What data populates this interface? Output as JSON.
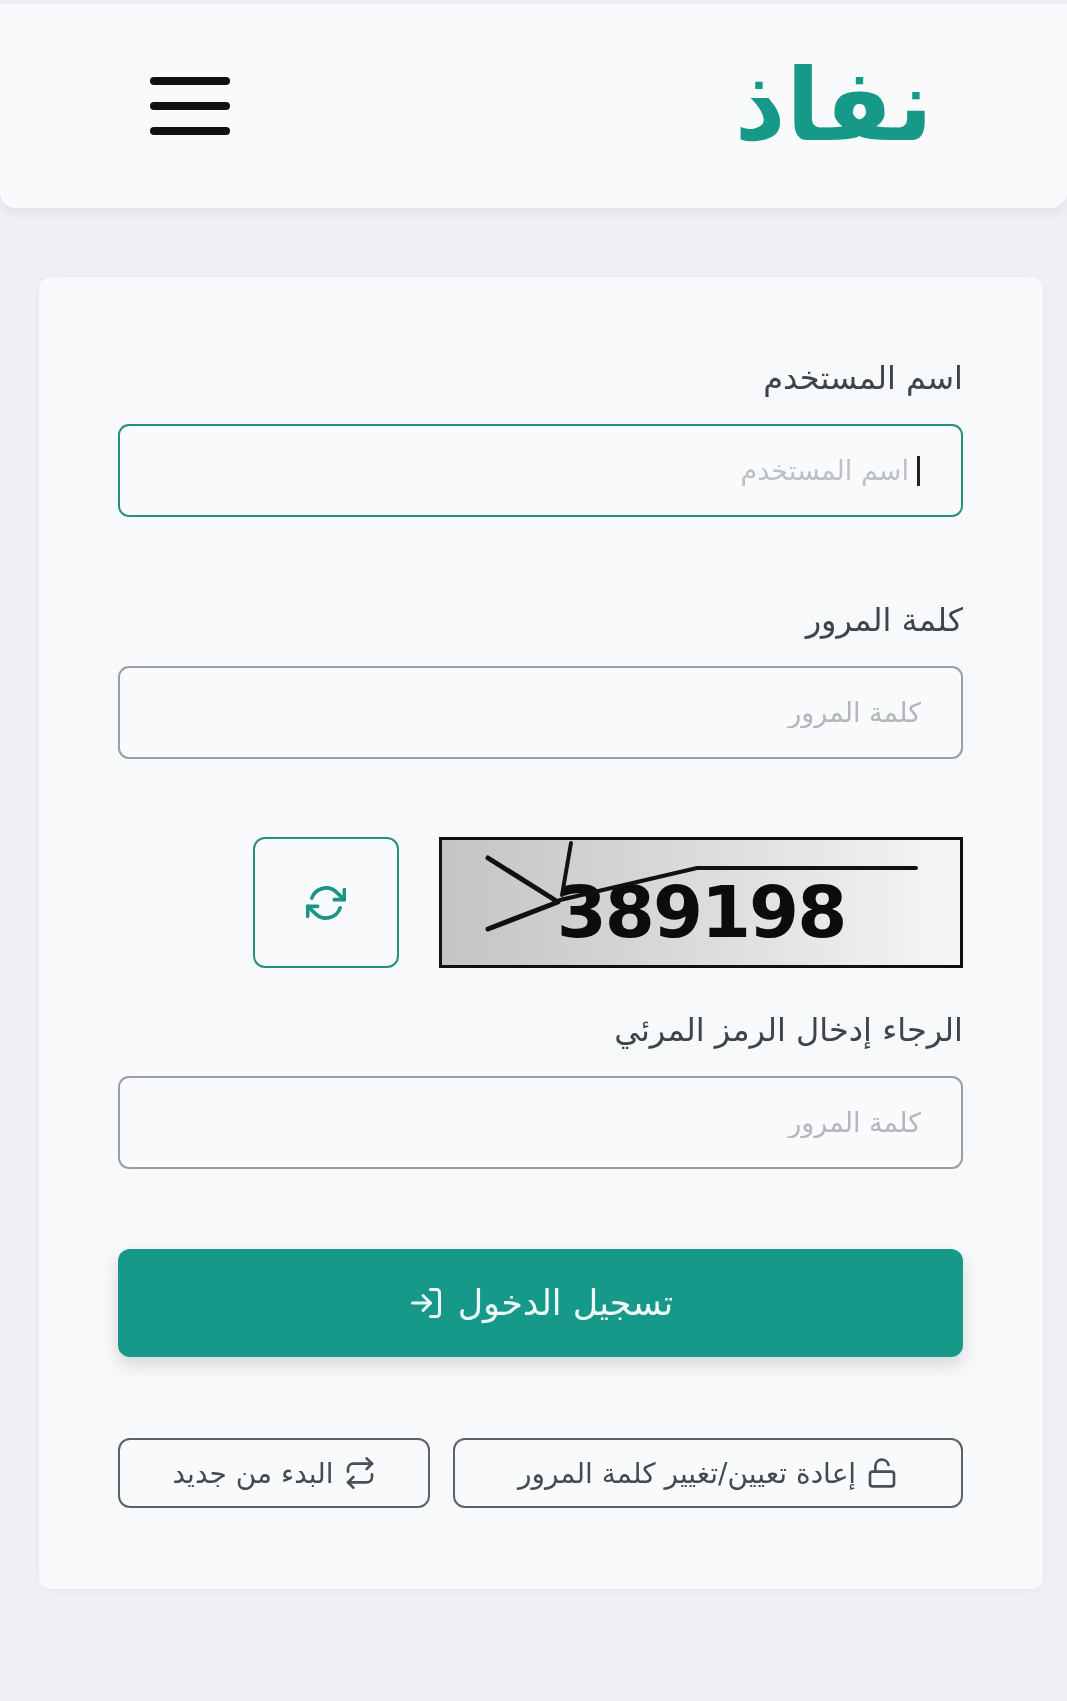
{
  "header": {
    "logo": "نفاذ"
  },
  "form": {
    "items": [
      {
        "kind": "field",
        "label": "اسم المستخدم",
        "placeholder": "اسم المستخدم",
        "focused": true
      },
      {
        "kind": "field",
        "label": "كلمة المرور",
        "placeholder": "كلمة المرور",
        "focused": false
      },
      {
        "kind": "captcha",
        "code": "389198"
      },
      {
        "kind": "field",
        "label": "الرجاء إدخال الرمز المرئي",
        "placeholder": "كلمة المرور",
        "focused": false
      }
    ],
    "login_button": {
      "label": "تسجيل الدخول"
    },
    "secondary_buttons": [
      {
        "kind": "unlock",
        "label": "إعادة تعيين/تغيير كلمة المرور"
      },
      {
        "kind": "restart",
        "label": "البدء من جديد"
      }
    ]
  }
}
